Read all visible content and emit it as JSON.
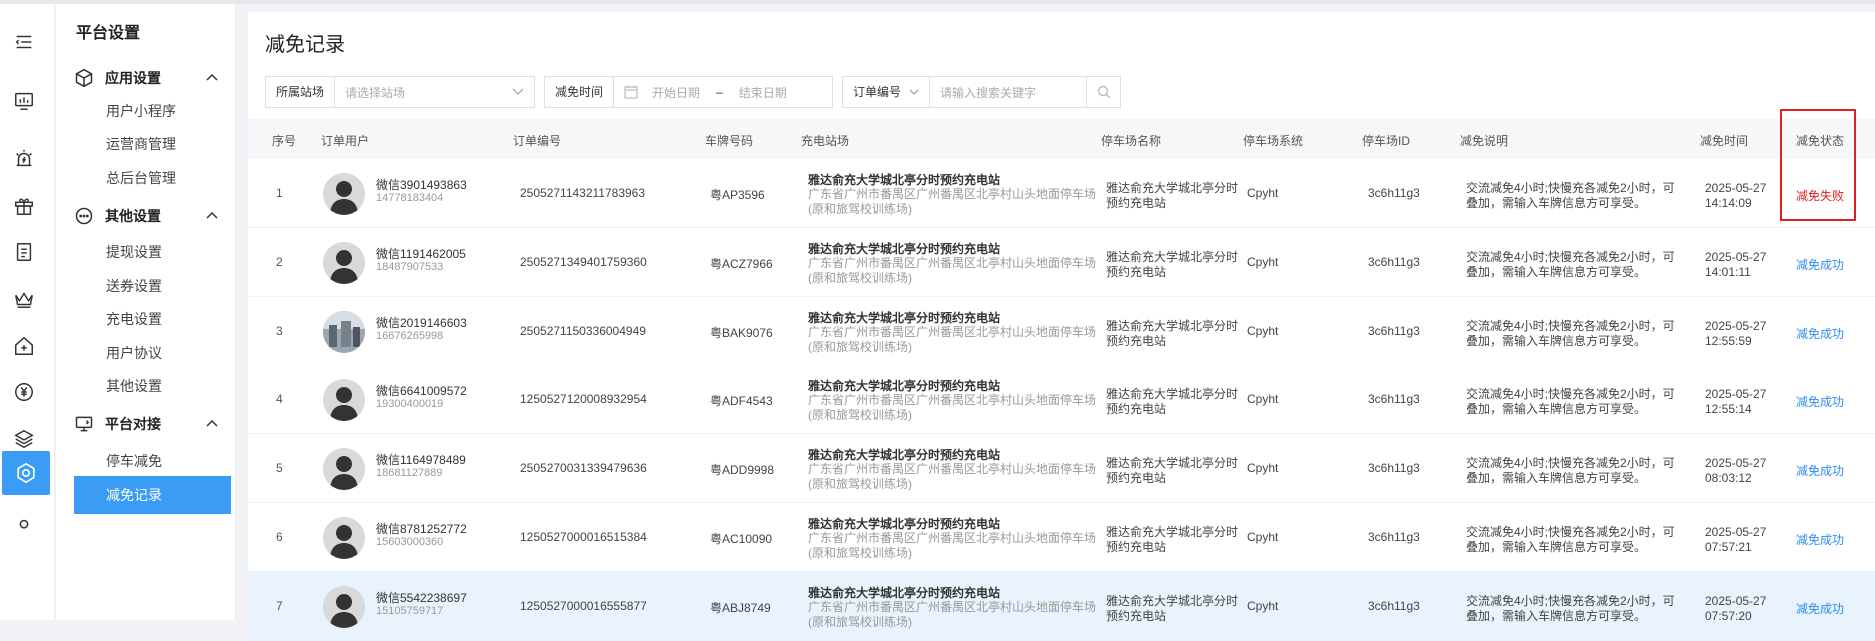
{
  "sidebar": {
    "title": "平台设置",
    "groups": [
      {
        "label": "应用设置",
        "items": [
          "用户小程序",
          "运营商管理",
          "总后台管理"
        ]
      },
      {
        "label": "其他设置",
        "items": [
          "提现设置",
          "送券设置",
          "充电设置",
          "用户协议",
          "其他设置"
        ]
      },
      {
        "label": "平台对接",
        "items": [
          "停车减免",
          "减免记录"
        ]
      }
    ],
    "active_item": "减免记录"
  },
  "iconbar": [
    "menu-icon",
    "monitor-chart-icon",
    "alarm-icon",
    "gift-icon",
    "document-list-icon",
    "crown-icon",
    "house-plus-icon",
    "yen-icon",
    "layers-icon",
    "settings-hexagon-icon",
    "user-icon"
  ],
  "page": {
    "title": "减免记录"
  },
  "filters": {
    "station_label": "所属站场",
    "station_placeholder": "请选择站场",
    "time_label": "减免时间",
    "start_placeholder": "开始日期",
    "date_sep": "–",
    "end_placeholder": "结束日期",
    "order_select": "订单编号",
    "search_placeholder": "请输入搜索关键字"
  },
  "table": {
    "headers": [
      "序号",
      "订单用户",
      "订单编号",
      "车牌号码",
      "充电站场",
      "停车场名称",
      "停车场系统",
      "停车场ID",
      "减免说明",
      "减免时间",
      "减免状态"
    ],
    "rows": [
      {
        "no": "1",
        "user": "微信3901493863",
        "phone": "14778183404",
        "order": "2505271143211783963",
        "plate": "粤AP3596",
        "station": "雅达俞充大学城北亭分时预约充电站",
        "addr": "广东省广州市番禺区广州番禺区北亭村山头地面停车场(原和旅驾校训练场)",
        "park": "雅达俞充大学城北亭分时预约充电站",
        "sys": "Cpyht",
        "pid": "3c6h11g3",
        "desc": "交流减免4小时;快慢充各减免2小时，可叠加，需输入车牌信息方可享受。",
        "time": "2025-05-27 14:14:09",
        "status": "减免失败",
        "status_color": "#e02020",
        "photo": false
      },
      {
        "no": "2",
        "user": "微信1191462005",
        "phone": "18487907533",
        "order": "2505271349401759360",
        "plate": "粤ACZ7966",
        "station": "雅达俞充大学城北亭分时预约充电站",
        "addr": "广东省广州市番禺区广州番禺区北亭村山头地面停车场(原和旅驾校训练场)",
        "park": "雅达俞充大学城北亭分时预约充电站",
        "sys": "Cpyht",
        "pid": "3c6h11g3",
        "desc": "交流减免4小时;快慢充各减免2小时，可叠加，需输入车牌信息方可享受。",
        "time": "2025-05-27 14:01:11",
        "status": "减免成功",
        "status_color": "#2f8bf0",
        "photo": false
      },
      {
        "no": "3",
        "user": "微信2019146603",
        "phone": "16676265998",
        "order": "2505271150336004949",
        "plate": "粤BAK9076",
        "station": "雅达俞充大学城北亭分时预约充电站",
        "addr": "广东省广州市番禺区广州番禺区北亭村山头地面停车场(原和旅驾校训练场)",
        "park": "雅达俞充大学城北亭分时预约充电站",
        "sys": "Cpyht",
        "pid": "3c6h11g3",
        "desc": "交流减免4小时;快慢充各减免2小时，可叠加，需输入车牌信息方可享受。",
        "time": "2025-05-27 12:55:59",
        "status": "减免成功",
        "status_color": "#2f8bf0",
        "photo": true
      },
      {
        "no": "4",
        "user": "微信6641009572",
        "phone": "19300400019",
        "order": "1250527120008932954",
        "plate": "粤ADF4543",
        "station": "雅达俞充大学城北亭分时预约充电站",
        "addr": "广东省广州市番禺区广州番禺区北亭村山头地面停车场(原和旅驾校训练场)",
        "park": "雅达俞充大学城北亭分时预约充电站",
        "sys": "Cpyht",
        "pid": "3c6h11g3",
        "desc": "交流减免4小时;快慢充各减免2小时，可叠加，需输入车牌信息方可享受。",
        "time": "2025-05-27 12:55:14",
        "status": "减免成功",
        "status_color": "#2f8bf0",
        "photo": false
      },
      {
        "no": "5",
        "user": "微信1164978489",
        "phone": "18681127889",
        "order": "2505270031339479636",
        "plate": "粤ADD9998",
        "station": "雅达俞充大学城北亭分时预约充电站",
        "addr": "广东省广州市番禺区广州番禺区北亭村山头地面停车场(原和旅驾校训练场)",
        "park": "雅达俞充大学城北亭分时预约充电站",
        "sys": "Cpyht",
        "pid": "3c6h11g3",
        "desc": "交流减免4小时;快慢充各减免2小时，可叠加，需输入车牌信息方可享受。",
        "time": "2025-05-27 08:03:12",
        "status": "减免成功",
        "status_color": "#2f8bf0",
        "photo": false
      },
      {
        "no": "6",
        "user": "微信8781252772",
        "phone": "15603000360",
        "order": "1250527000016515384",
        "plate": "粤AC10090",
        "station": "雅达俞充大学城北亭分时预约充电站",
        "addr": "广东省广州市番禺区广州番禺区北亭村山头地面停车场(原和旅驾校训练场)",
        "park": "雅达俞充大学城北亭分时预约充电站",
        "sys": "Cpyht",
        "pid": "3c6h11g3",
        "desc": "交流减免4小时;快慢充各减免2小时，可叠加，需输入车牌信息方可享受。",
        "time": "2025-05-27 07:57:21",
        "status": "减免成功",
        "status_color": "#2f8bf0",
        "photo": false
      },
      {
        "no": "7",
        "user": "微信5542238697",
        "phone": "15105759717",
        "order": "1250527000016555877",
        "plate": "粤ABJ8749",
        "station": "雅达俞充大学城北亭分时预约充电站",
        "addr": "广东省广州市番禺区广州番禺区北亭村山头地面停车场(原和旅驾校训练场)",
        "park": "雅达俞充大学城北亭分时预约充电站",
        "sys": "Cpyht",
        "pid": "3c6h11g3",
        "desc": "交流减免4小时;快慢充各减免2小时，可叠加，需输入车牌信息方可享受。",
        "time": "2025-05-27 07:57:20",
        "status": "减免成功",
        "status_color": "#2f8bf0",
        "photo": false
      }
    ]
  },
  "colors": {
    "accent": "#3a9cf4",
    "success": "#2f8bf0",
    "fail": "#e02020",
    "highlight_box": "#e02020"
  }
}
